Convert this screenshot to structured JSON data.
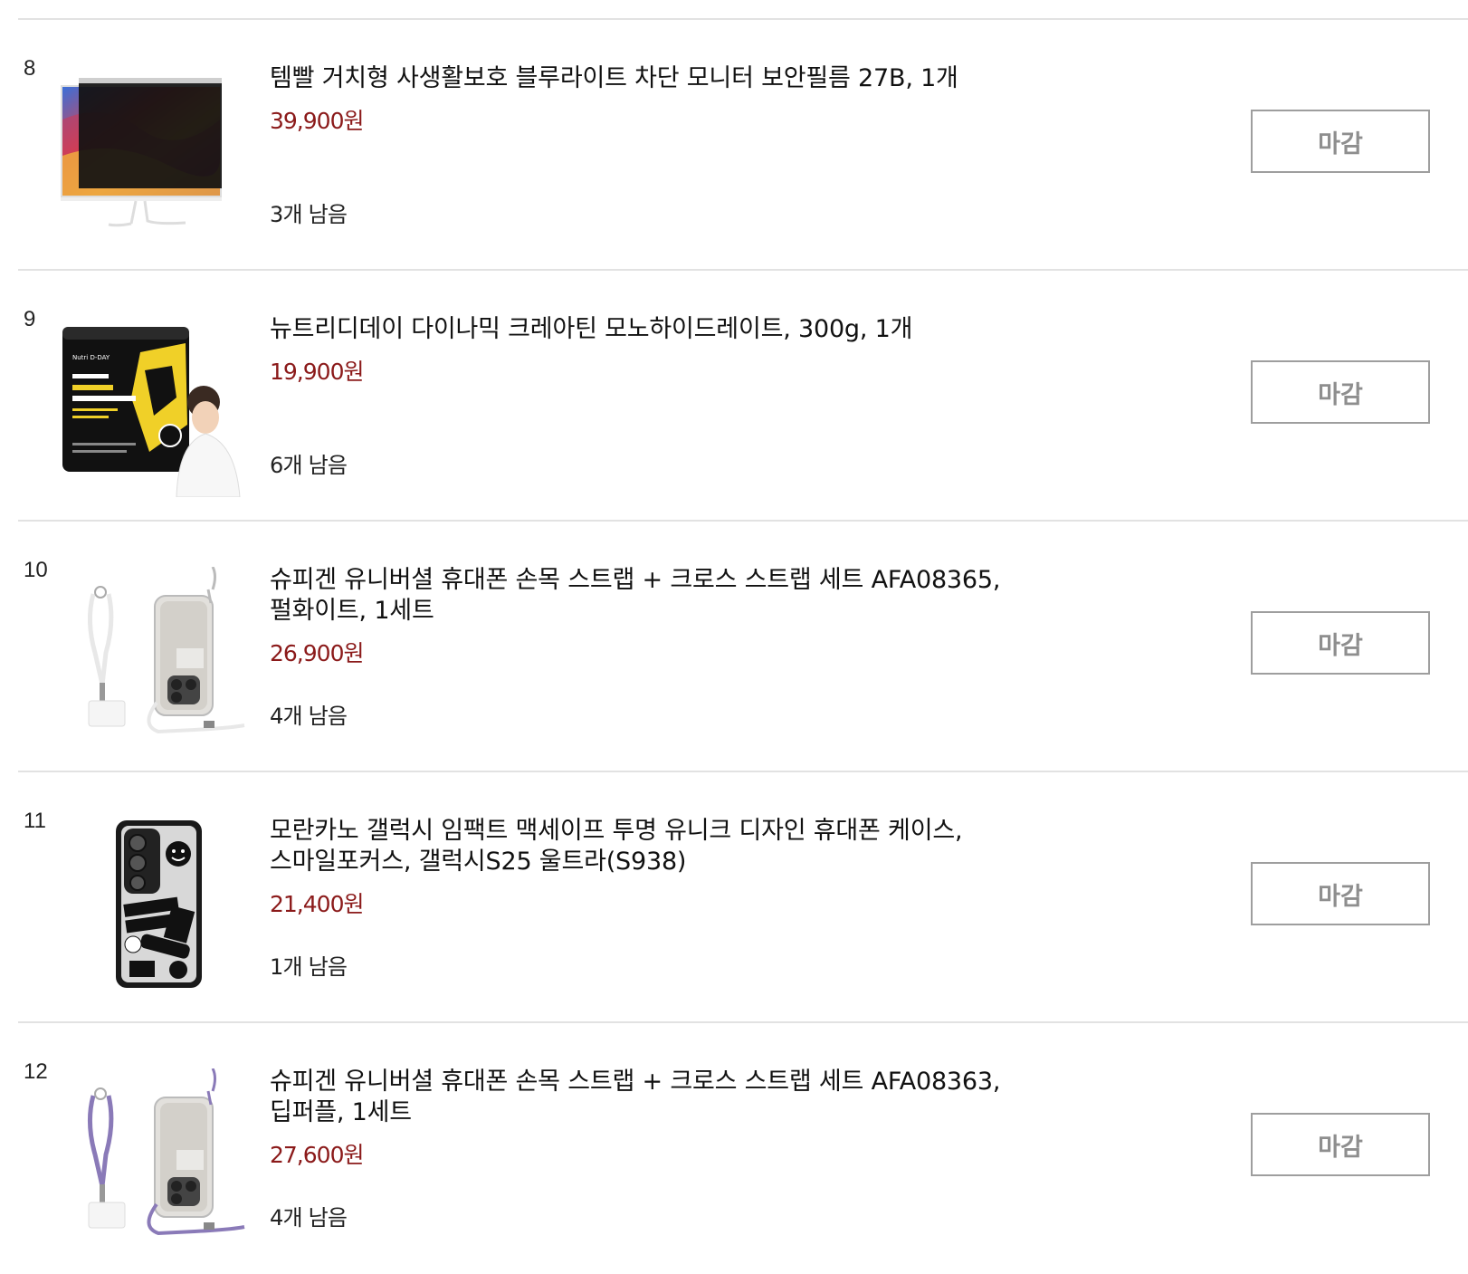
{
  "items": [
    {
      "rank": "8",
      "title": "템빨 거치형 사생활보호 블루라이트 차단 모니터 보안필름 27B, 1개",
      "price": "39,900원",
      "stock": "3개 남음",
      "button": "마감"
    },
    {
      "rank": "9",
      "title": "뉴트리디데이 다이나믹 크레아틴 모노하이드레이트, 300g, 1개",
      "price": "19,900원",
      "stock": "6개 남음",
      "button": "마감"
    },
    {
      "rank": "10",
      "title": "슈피겐 유니버셜 휴대폰 손목 스트랩 + 크로스 스트랩 세트 AFA08365, 펄화이트, 1세트",
      "price": "26,900원",
      "stock": "4개 남음",
      "button": "마감"
    },
    {
      "rank": "11",
      "title": "모란카노 갤럭시 임팩트 맥세이프 투명 유니크 디자인 휴대폰 케이스, 스마일포커스, 갤럭시S25 울트라(S938)",
      "price": "21,400원",
      "stock": "1개 남음",
      "button": "마감"
    },
    {
      "rank": "12",
      "title": "슈피겐 유니버셜 휴대폰 손목 스트랩 + 크로스 스트랩 세트 AFA08363, 딥퍼플, 1세트",
      "price": "27,600원",
      "stock": "4개 남음",
      "button": "마감"
    }
  ],
  "thumb_labels": {
    "item9_brand": "Nutri D-DAY",
    "item9_product": "다이나믹 크레아틴 모노하이드레이트"
  },
  "colors": {
    "price": "#8b1a1a",
    "divider": "#e2e2e2",
    "button_border": "#9e9e9e",
    "button_text": "#8e8e8e",
    "strap_white": "#e8e8e8",
    "strap_purple": "#8a7ab8"
  }
}
